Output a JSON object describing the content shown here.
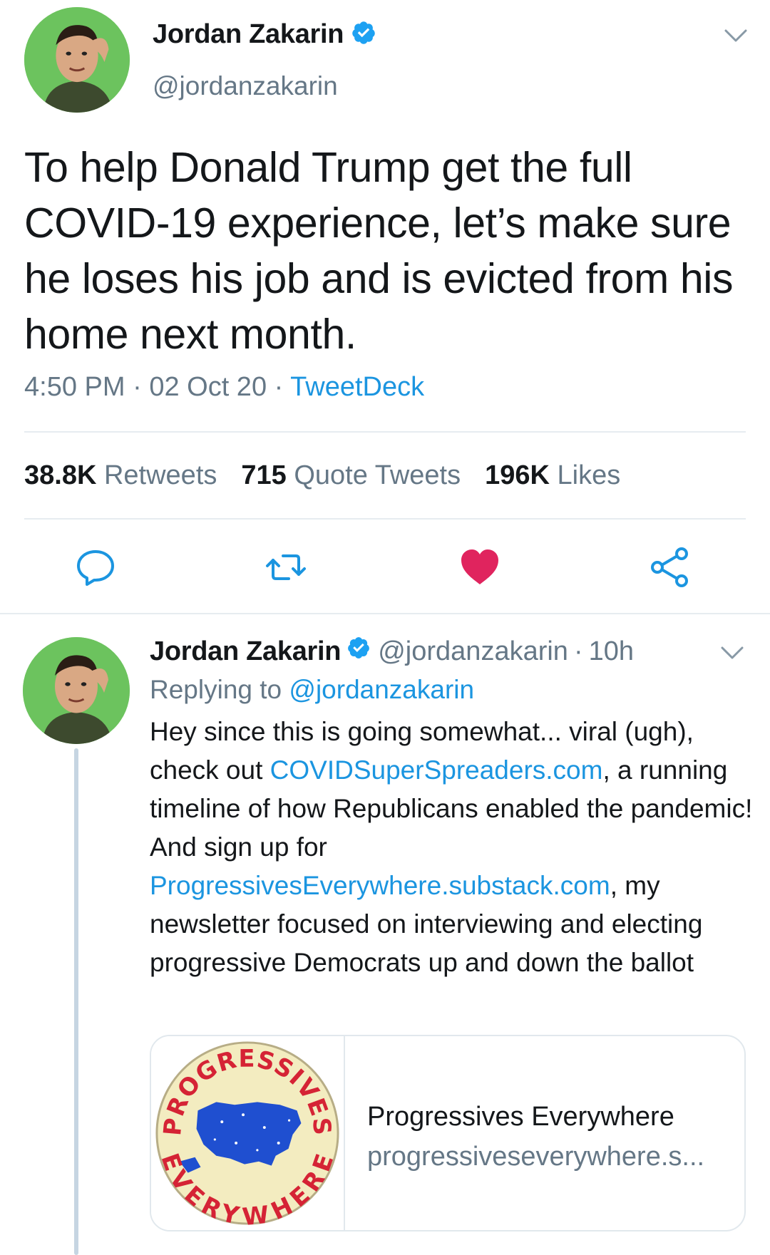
{
  "main_tweet": {
    "author_name": "Jordan Zakarin",
    "author_handle": "@jordanzakarin",
    "text": "To help Donald Trump get the full COVID-19 experience, let’s make sure he loses his job and is evicted from his home next month.",
    "time": "4:50 PM",
    "date": "02 Oct 20",
    "separator": "·",
    "source": "TweetDeck",
    "stats": {
      "retweets_count": "38.8K",
      "retweets_label": "Retweets",
      "quotes_count": "715",
      "quotes_label": "Quote Tweets",
      "likes_count": "196K",
      "likes_label": "Likes"
    },
    "actions": [
      "reply-icon",
      "retweet-icon",
      "heart-icon",
      "share-icon"
    ],
    "liked": true
  },
  "reply_tweet": {
    "author_name": "Jordan Zakarin",
    "author_handle": "@jordanzakarin",
    "separator": "·",
    "time": "10h",
    "replying_label": "Replying to",
    "replying_handle": "@jordanzakarin",
    "text_part1": "Hey since this is going somewhat... viral (ugh), check out ",
    "link1": "COVIDSuperSpreaders.com",
    "text_part2": ", a running timeline of how Republicans enabled the pandemic! And sign up for ",
    "link2": "ProgressivesEverywhere.substack.com",
    "text_part3": ", my newsletter focused on interviewing and electing progressive Democrats up and down the ballot",
    "card": {
      "title": "Progressives Everywhere",
      "domain": "progressiveseverywhere.s...",
      "logo_text_top": "PROGRESSIVES",
      "logo_text_bottom": "EVERYWHERE"
    }
  },
  "colors": {
    "text": "#14171a",
    "secondary": "#657786",
    "link": "#1b95e0",
    "verified": "#1da1f2",
    "like": "#e0245e",
    "divider": "#e6ecf0"
  }
}
